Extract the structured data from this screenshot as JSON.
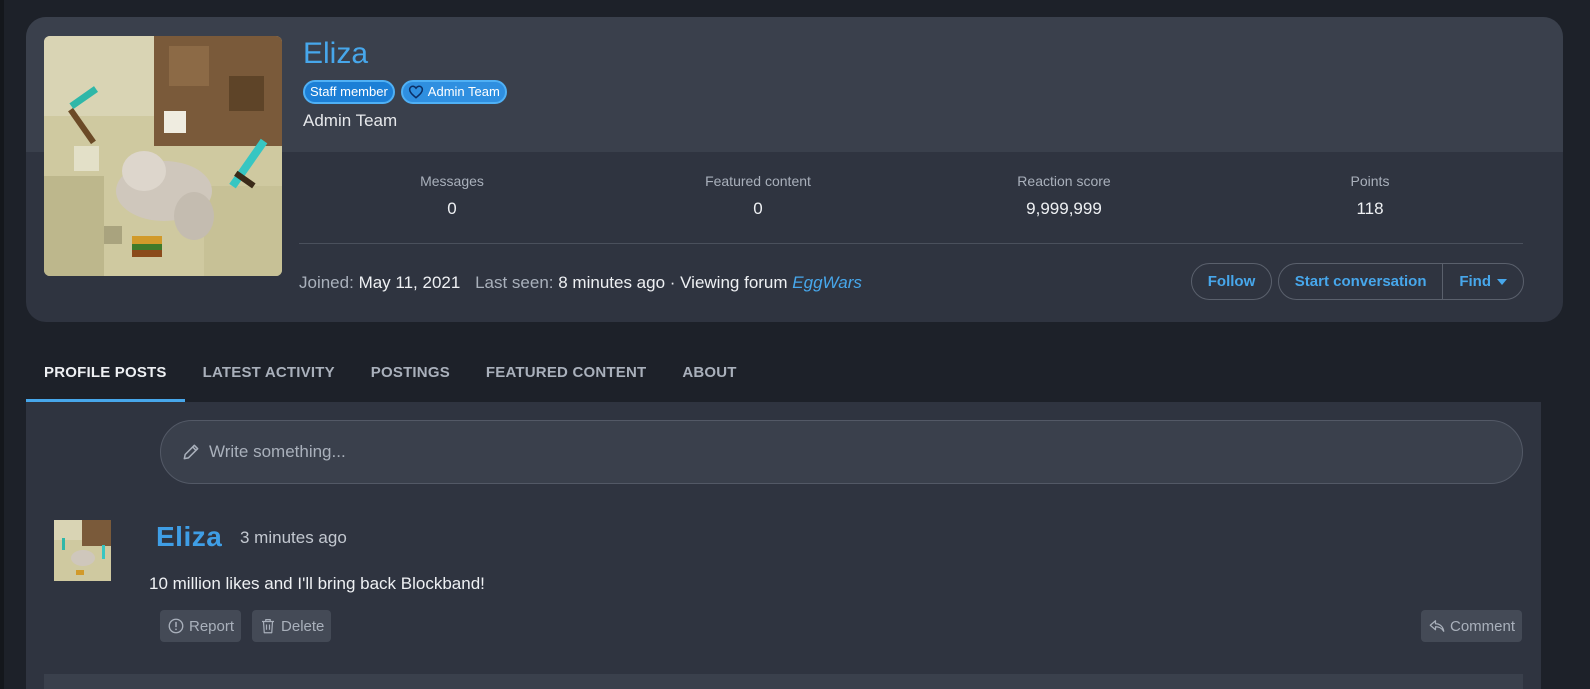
{
  "profile": {
    "username": "Eliza",
    "badges": [
      {
        "label": "Staff member"
      },
      {
        "label": "Admin Team",
        "icon": "heart-icon"
      }
    ],
    "user_title": "Admin Team",
    "stats": [
      {
        "label": "Messages",
        "value": "0"
      },
      {
        "label": "Featured content",
        "value": "0"
      },
      {
        "label": "Reaction score",
        "value": "9,999,999"
      },
      {
        "label": "Points",
        "value": "118"
      }
    ],
    "meta": {
      "joined_label": "Joined:",
      "joined_value": "May 11, 2021",
      "last_seen_label": "Last seen:",
      "last_seen_value": "8 minutes ago · Viewing forum",
      "forum_link": "EggWars"
    },
    "actions": {
      "follow": "Follow",
      "start_conversation": "Start conversation",
      "find": "Find"
    }
  },
  "tabs": [
    {
      "label": "PROFILE POSTS",
      "active": true
    },
    {
      "label": "LATEST ACTIVITY"
    },
    {
      "label": "POSTINGS"
    },
    {
      "label": "FEATURED CONTENT"
    },
    {
      "label": "ABOUT"
    }
  ],
  "composer": {
    "placeholder": "Write something...",
    "icon": "pencil-icon"
  },
  "post": {
    "author": "Eliza",
    "time": "3 minutes ago",
    "body": "10 million likes and I'll bring back Blockband!",
    "actions": {
      "report": "Report",
      "delete": "Delete",
      "comment": "Comment"
    }
  },
  "colors": {
    "accent": "#47a7eb",
    "page_bg": "#1d2129",
    "card_bg": "#2f3440",
    "card_top_bg": "#3a404c"
  }
}
